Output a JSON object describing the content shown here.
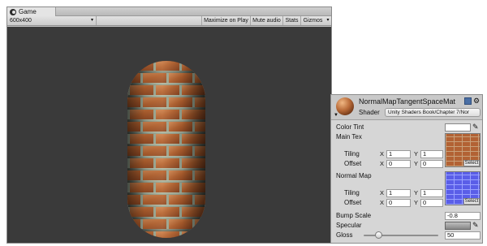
{
  "game_window": {
    "tab_label": "Game",
    "resolution": "600x400",
    "toolbar": {
      "maximize_on_play": "Maximize on Play",
      "mute_audio": "Mute audio",
      "stats": "Stats",
      "gizmos": "Gizmos"
    },
    "viewport_background": "#3a3a3a"
  },
  "inspector": {
    "material_name": "NormalMapTangentSpaceMat",
    "shader_label": "Shader",
    "shader_value": "Unity Shaders Book/Chapter 7/Nor",
    "properties": {
      "color_tint_label": "Color Tint",
      "color_tint_value": "#ffffff",
      "main_tex_label": "Main Tex",
      "main_tex_tiling_label": "Tiling",
      "main_tex_tiling_x": "1",
      "main_tex_tiling_y": "1",
      "main_tex_offset_label": "Offset",
      "main_tex_offset_x": "0",
      "main_tex_offset_y": "0",
      "normal_map_label": "Normal Map",
      "normal_map_tiling_label": "Tiling",
      "normal_map_tiling_x": "1",
      "normal_map_tiling_y": "1",
      "normal_map_offset_label": "Offset",
      "normal_map_offset_x": "0",
      "normal_map_offset_y": "0",
      "axis_x": "X",
      "axis_y": "Y",
      "select_label": "Select",
      "bump_scale_label": "Bump Scale",
      "bump_scale_value": "-0.8",
      "specular_label": "Specular",
      "gloss_label": "Gloss",
      "gloss_value": "50",
      "gloss_slider_fraction": 0.2
    }
  }
}
